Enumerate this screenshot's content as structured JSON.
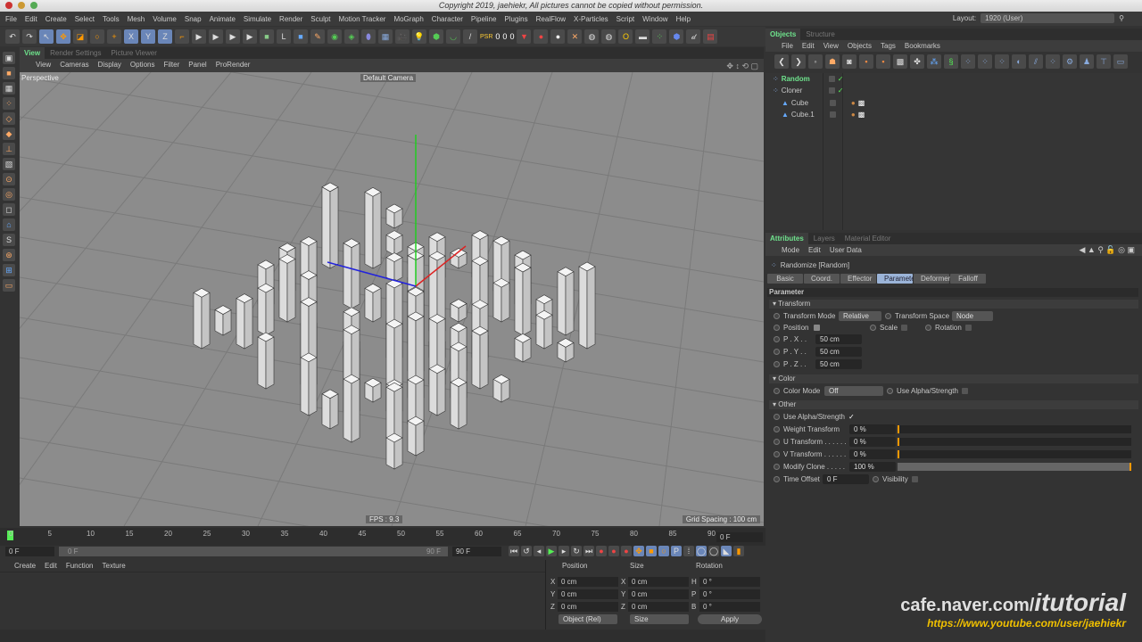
{
  "window": {
    "copyright": "Copyright 2019, jaehiekr, All pictures cannot be copied without permission."
  },
  "menubar": {
    "items": [
      "File",
      "Edit",
      "Create",
      "Select",
      "Tools",
      "Mesh",
      "Volume",
      "Snap",
      "Animate",
      "Simulate",
      "Render",
      "Sculpt",
      "Motion Tracker",
      "MoGraph",
      "Character",
      "Pipeline",
      "Plugins",
      "RealFlow",
      "X-Particles",
      "Script",
      "Window",
      "Help"
    ],
    "layout_label": "Layout:",
    "layout_value": "1920 (User)"
  },
  "toolbar": {
    "psr": {
      "label": "PSR",
      "p": "0",
      "s": "0",
      "r": "0"
    }
  },
  "viewport_panel": {
    "tabs": [
      "View",
      "Render Settings",
      "Picture Viewer"
    ],
    "menu": [
      "View",
      "Cameras",
      "Display",
      "Options",
      "Filter",
      "Panel",
      "ProRender"
    ],
    "view_name": "Perspective",
    "camera": "Default Camera",
    "fps": "FPS : 9.3",
    "grid_spacing": "Grid Spacing : 100 cm"
  },
  "timeline": {
    "ticks": [
      "0",
      "5",
      "10",
      "15",
      "20",
      "25",
      "30",
      "35",
      "40",
      "45",
      "50",
      "55",
      "60",
      "65",
      "70",
      "75",
      "80",
      "85",
      "90"
    ],
    "current_frame": "0 F",
    "start": "0 F",
    "range_start": "0 F",
    "range_end": "90 F",
    "end": "90 F"
  },
  "material_manager": {
    "menu": [
      "Create",
      "Edit",
      "Function",
      "Texture"
    ]
  },
  "coordinates": {
    "headers": [
      "Position",
      "Size",
      "Rotation"
    ],
    "rows": [
      {
        "a": "X",
        "pos": "0 cm",
        "b": "X",
        "size": "0 cm",
        "c": "H",
        "rot": "0 °"
      },
      {
        "a": "Y",
        "pos": "0 cm",
        "b": "Y",
        "size": "0 cm",
        "c": "P",
        "rot": "0 °"
      },
      {
        "a": "Z",
        "pos": "0 cm",
        "b": "Z",
        "size": "0 cm",
        "c": "B",
        "rot": "0 °"
      }
    ],
    "mode": "Object (Rel)",
    "size_mode": "Size",
    "apply": "Apply"
  },
  "object_manager": {
    "tabs": [
      "Objects",
      "Structure"
    ],
    "menu": [
      "File",
      "Edit",
      "View",
      "Objects",
      "Tags",
      "Bookmarks"
    ],
    "objects": [
      {
        "name": "Random",
        "indent": 0,
        "selected": true
      },
      {
        "name": "Cloner",
        "indent": 0
      },
      {
        "name": "Cube",
        "indent": 1
      },
      {
        "name": "Cube.1",
        "indent": 1
      }
    ]
  },
  "attributes": {
    "tabs": [
      "Attributes",
      "Layers",
      "Material Editor"
    ],
    "menu": [
      "Mode",
      "Edit",
      "User Data"
    ],
    "object_title": "Randomize [Random]",
    "subtabs": [
      "Basic",
      "Coord.",
      "Effector",
      "Parameter",
      "Deformer",
      "Falloff"
    ],
    "active_subtab": "Parameter",
    "section": "Parameter",
    "transform": {
      "title": "Transform",
      "mode_label": "Transform Mode",
      "mode_value": "Relative",
      "space_label": "Transform Space",
      "space_value": "Node",
      "position": "Position",
      "scale": "Scale",
      "rotation": "Rotation",
      "px_label": "P . X . .",
      "px": "50 cm",
      "py_label": "P . Y . .",
      "py": "50 cm",
      "pz_label": "P . Z . .",
      "pz": "50 cm"
    },
    "color": {
      "title": "Color",
      "mode_label": "Color Mode",
      "mode_value": "Off",
      "alpha_label": "Use Alpha/Strength"
    },
    "other": {
      "title": "Other",
      "alpha_label": "Use Alpha/Strength",
      "alpha_check": "✓",
      "weight_label": "Weight Transform",
      "weight": "0 %",
      "weight_frac": 0,
      "u_label": "U Transform . . . . . .",
      "u": "0 %",
      "u_frac": 0,
      "v_label": "V Transform . . . . . .",
      "v": "0 %",
      "v_frac": 0,
      "modify_label": "Modify Clone . . . . .",
      "modify": "100 %",
      "modify_frac": 1,
      "time_label": "Time Offset",
      "time": "0 F",
      "visibility": "Visibility"
    }
  },
  "watermark": {
    "line1": "cafe.naver.com/",
    "line1b": "itutorial",
    "line2": "https://www.youtube.com/user/jaehiekr"
  }
}
